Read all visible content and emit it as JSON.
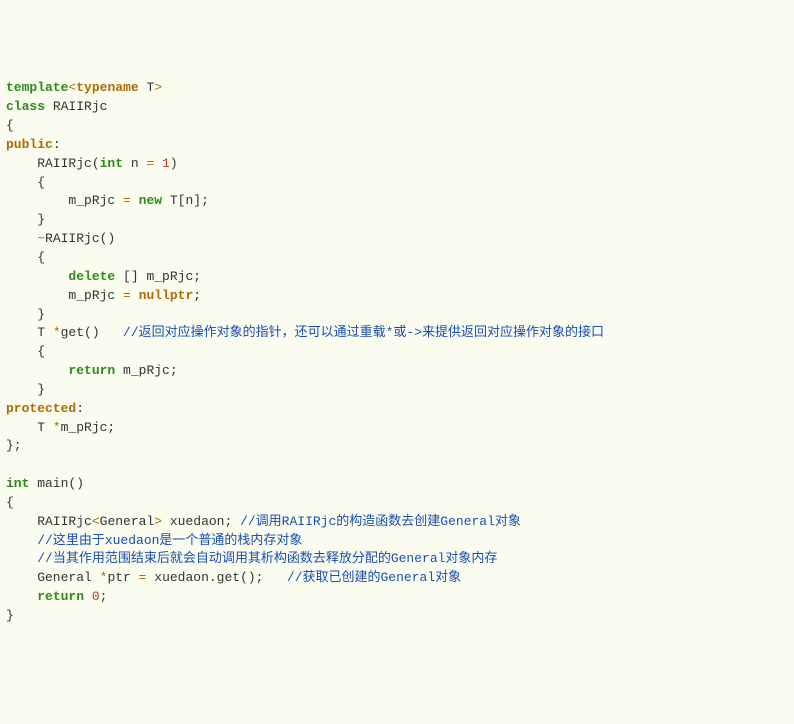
{
  "code": {
    "l1": {
      "a": "template",
      "b": "<",
      "c": "typename",
      "d": " T",
      "e": ">"
    },
    "l2": {
      "a": "class",
      "b": " RAIIRjc"
    },
    "l3": {
      "a": "{"
    },
    "l4": {
      "a": "public",
      "b": ":"
    },
    "l5": {
      "a": "    RAIIRjc(",
      "b": "int",
      "c": " n ",
      "d": "=",
      "e": " ",
      "f": "1",
      "g": ")"
    },
    "l6": {
      "a": "    {"
    },
    "l7": {
      "a": "        m_pRjc ",
      "b": "=",
      "c": " ",
      "d": "new",
      "e": " T[n];"
    },
    "l8": {
      "a": "    }"
    },
    "l9": {
      "a": "    ",
      "b": "~",
      "c": "RAIIRjc()"
    },
    "l10": {
      "a": "    {"
    },
    "l11": {
      "a": "        ",
      "b": "delete",
      "c": " [] m_pRjc;"
    },
    "l12": {
      "a": "        m_pRjc ",
      "b": "=",
      "c": " ",
      "d": "nullptr",
      "e": ";"
    },
    "l13": {
      "a": "    }"
    },
    "l14": {
      "a": "    T ",
      "b": "*",
      "c": "get()   ",
      "d": "//返回对应操作对象的指针，还可以通过重载*或->来提供返回对应操作对象的接口"
    },
    "l15": {
      "a": "    {"
    },
    "l16": {
      "a": "        ",
      "b": "return",
      "c": " m_pRjc;"
    },
    "l17": {
      "a": "    }"
    },
    "l18": {
      "a": "protected",
      "b": ":"
    },
    "l19": {
      "a": "    T ",
      "b": "*",
      "c": "m_pRjc;"
    },
    "l20": {
      "a": "};"
    },
    "l21": {
      "a": ""
    },
    "l22": {
      "a": "int",
      "b": " main()"
    },
    "l23": {
      "a": "{"
    },
    "l24": {
      "a": "    RAIIRjc",
      "b": "<",
      "c": "General",
      "d": ">",
      "e": " xuedaon; ",
      "f": "//调用RAIIRjc的构造函数去创建General对象"
    },
    "l25": {
      "a": "    ",
      "b": "//这里由于xuedaon是一个普通的栈内存对象"
    },
    "l26": {
      "a": "    ",
      "b": "//当其作用范围结束后就会自动调用其析构函数去释放分配的General对象内存"
    },
    "l27": {
      "a": "    General ",
      "b": "*",
      "c": "ptr ",
      "d": "=",
      "e": " xuedaon.get();   ",
      "f": "//获取已创建的General对象"
    },
    "l28": {
      "a": "    ",
      "b": "return",
      "c": " ",
      "d": "0",
      "e": ";"
    },
    "l29": {
      "a": "}"
    }
  }
}
